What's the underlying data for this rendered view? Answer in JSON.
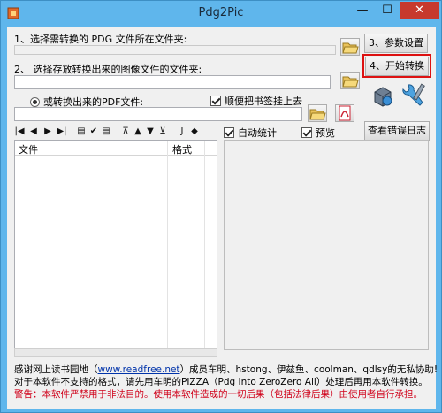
{
  "window": {
    "title": "Pdg2Pic",
    "minimize": "—",
    "maximize": "☐",
    "close": "✕"
  },
  "source": {
    "label": "1、选择需转换的 PDG 文件所在文件夹:",
    "value": ""
  },
  "output": {
    "image_option_label": "2、 选择存放转换出来的图像文件的文件夹:",
    "image_value": "",
    "pdf_option_label": "或转换出来的PDF文件:",
    "pdf_value": "",
    "bookmark_label": "顺便把书签挂上去"
  },
  "buttons": {
    "settings": "3、参数设置",
    "convert": "4、开始转换",
    "view_log": "查看错误日志"
  },
  "options": {
    "auto_count": "自动统计",
    "preview": "预览"
  },
  "toolbar": {
    "first": "|◀",
    "prev": "◀",
    "next": "▶",
    "last": "▶|",
    "t1": "▤",
    "t2": "✔",
    "t3": "▤",
    "t4": "⊼",
    "t5": "▲",
    "t6": "▼",
    "t7": "⊻",
    "t8": "J",
    "t9": "◆"
  },
  "file_list": {
    "col_file": "文件",
    "col_format": "格式"
  },
  "footer": {
    "thanks_prefix": "感谢网上读书园地（",
    "thanks_link": "www.readfree.net",
    "thanks_suffix": "）成员车明、hstong、伊兹鱼、coolman、qdlsy的无私协助!",
    "note": "对于本软件不支持的格式，请先用车明的PIZZA（Pdg Into ZeroZero All）处理后再用本软件转换。",
    "warning": "警告：本软件严禁用于非法目的。使用本软件造成的一切后果（包括法律后果）由使用者自行承担。"
  }
}
